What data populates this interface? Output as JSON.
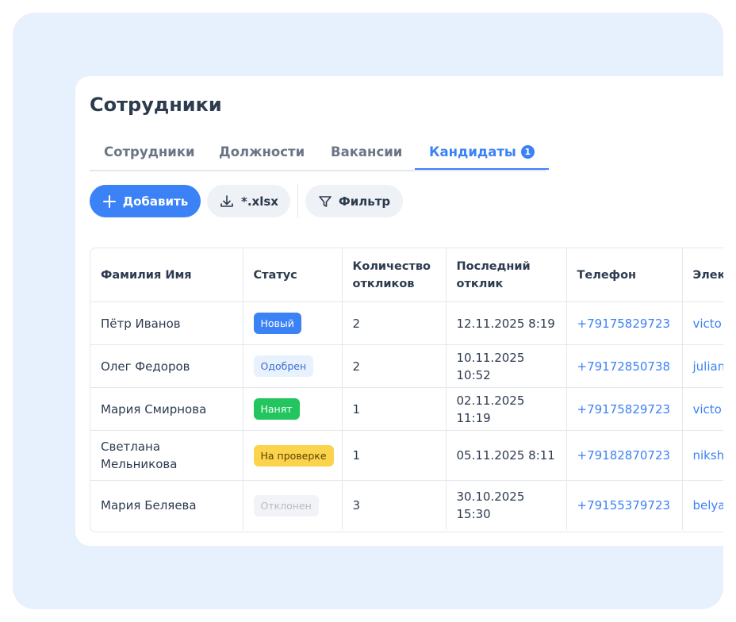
{
  "page": {
    "title": "Сотрудники"
  },
  "tabs": [
    {
      "label": "Сотрудники"
    },
    {
      "label": "Должности"
    },
    {
      "label": "Вакансии"
    },
    {
      "label": "Кандидаты",
      "badge": "1",
      "active": true
    }
  ],
  "toolbar": {
    "add_label": "Добавить",
    "export_label": "*.xlsx",
    "filter_label": "Фильтр"
  },
  "table": {
    "headers": [
      "Фамилия Имя",
      "Статус",
      "Количество откликов",
      "Последний отклик",
      "Телефон",
      "Элек"
    ],
    "rows": [
      {
        "name": "Пётр Иванов",
        "status": "Новый",
        "responses": "2",
        "last": "12.11.2025 8:19",
        "phone": "+79175829723",
        "email": "victo"
      },
      {
        "name": "Олег Федоров",
        "status": "Одобрен",
        "responses": "2",
        "last": "10.11.2025 10:52",
        "phone": "+79172850738",
        "email": "julian"
      },
      {
        "name": "Мария Смирнова",
        "status": "Нанят",
        "responses": "1",
        "last": "02.11.2025 11:19",
        "phone": "+79175829723",
        "email": "victo"
      },
      {
        "name": "Светлана Мельникова",
        "status": "На проверке",
        "responses": "1",
        "last": "05.11.2025 8:11",
        "phone": "+79182870723",
        "email": "niksh"
      },
      {
        "name": "Мария Беляева",
        "status": "Отклонен",
        "responses": "3",
        "last": "30.10.2025 15:30",
        "phone": "+79155379723",
        "email": "belya com"
      }
    ]
  },
  "colors": {
    "accent": "#3b82f6",
    "background": "#e7f0fd",
    "status_new": "#3b82f6",
    "status_approved": "#e8f1fe",
    "status_hired": "#22c55e",
    "status_review": "#fcd34d",
    "status_rejected": "#f1f3f6"
  },
  "icons": {
    "add": "plus-icon",
    "export": "download-icon",
    "filter": "funnel-icon"
  }
}
